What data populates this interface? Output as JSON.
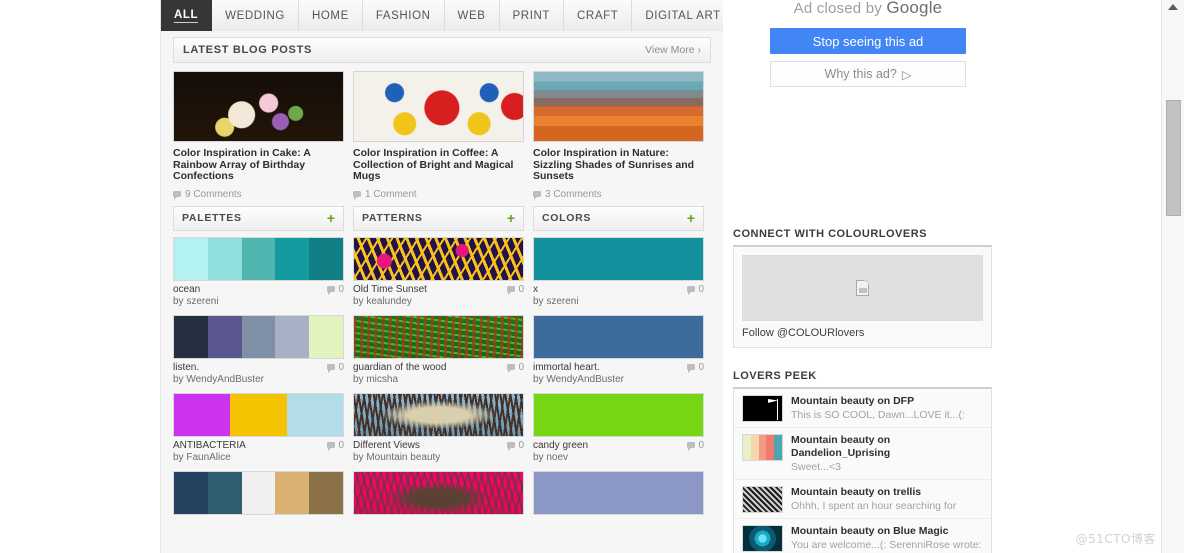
{
  "nav": {
    "tabs": [
      {
        "label": "ALL",
        "active": true
      },
      {
        "label": "WEDDING",
        "active": false
      },
      {
        "label": "HOME",
        "active": false
      },
      {
        "label": "FASHION",
        "active": false
      },
      {
        "label": "WEB",
        "active": false
      },
      {
        "label": "PRINT",
        "active": false
      },
      {
        "label": "CRAFT",
        "active": false
      },
      {
        "label": "DIGITAL ART",
        "active": false
      }
    ]
  },
  "blog_section": {
    "title": "LATEST BLOG POSTS",
    "more_label": "View More ›",
    "posts": [
      {
        "title": "Color Inspiration in Cake: A Rainbow Array of Birthday Confections",
        "comments": "9 Comments",
        "thumb": "img-cake"
      },
      {
        "title": "Color Inspiration in Coffee: A Collection of Bright and Magical Mugs",
        "comments": "1 Comment",
        "thumb": "img-mug"
      },
      {
        "title": "Color Inspiration in Nature: Sizzling Shades of Sunrises and Sunsets",
        "comments": "3 Comments",
        "thumb": "img-sunset"
      }
    ]
  },
  "columns": [
    {
      "title": "PALETTES",
      "add_icon": "plus-icon",
      "add_label": "+",
      "items": [
        {
          "name": "ocean",
          "by": "by szereni",
          "count": "0",
          "swatches": [
            "#b4f2f2",
            "#8fe0dd",
            "#4fb5ae",
            "#139ba0",
            "#0f7e85"
          ]
        },
        {
          "name": "listen.",
          "by": "by WendyAndBuster",
          "count": "0",
          "swatches": [
            "#24303f",
            "#5a5790",
            "#7f8fa6",
            "#a7b0c4",
            "#e2f3bd"
          ]
        },
        {
          "name": "ANTIBACTERIA",
          "by": "by FaunAlice",
          "count": "0",
          "swatches": [
            "#cc33ee",
            "#f5c400",
            "#b2dde8"
          ]
        },
        {
          "name": "",
          "by": "",
          "count": "",
          "swatches": [
            "#234260",
            "#2f5d72",
            "#f1eff0",
            "#d9b173",
            "#8a7148"
          ]
        }
      ]
    },
    {
      "title": "PATTERNS",
      "add_icon": "plus-icon",
      "add_label": "+",
      "items": [
        {
          "name": "Old Time Sunset",
          "by": "by kealundey",
          "count": "0",
          "pattern": "pat1"
        },
        {
          "name": "guardian of the wood",
          "by": "by micsha",
          "count": "0",
          "pattern": "pat2"
        },
        {
          "name": "Different Views",
          "by": "by Mountain beauty",
          "count": "0",
          "pattern": "pat3"
        },
        {
          "name": "",
          "by": "",
          "count": "",
          "pattern": "pat4"
        }
      ]
    },
    {
      "title": "COLORS",
      "add_icon": "plus-icon",
      "add_label": "+",
      "items": [
        {
          "name": "x",
          "by": "by szereni",
          "count": "0",
          "swatches": [
            "#13909c"
          ]
        },
        {
          "name": "immortal heart.",
          "by": "by WendyAndBuster",
          "count": "0",
          "swatches": [
            "#3d6b9c"
          ]
        },
        {
          "name": "candy green",
          "by": "by noev",
          "count": "0",
          "swatches": [
            "#76d614"
          ]
        },
        {
          "name": "",
          "by": "",
          "count": "",
          "swatches": [
            "#8b97c4"
          ]
        }
      ]
    }
  ],
  "ad": {
    "closed_text": "Ad closed by ",
    "closed_brand": "Google",
    "stop_label": "Stop seeing this ad",
    "why_label": "Why this ad?",
    "why_icon": "play-triangle-icon"
  },
  "connect": {
    "title": "CONNECT WITH COLOURLOVERS",
    "image_icon": "broken-image-icon",
    "follow_label": "Follow @COLOURlovers"
  },
  "lovers_peek": {
    "title": "LOVERS PEEK",
    "items": [
      {
        "title": "Mountain beauty on DFP",
        "text": "This is SO COOL, Dawn...LOVE it...(:",
        "thumb": "th-dfp"
      },
      {
        "title": "Mountain beauty on Dandelion_Uprising",
        "text": "Sweet...<3",
        "thumb": "th-dand"
      },
      {
        "title": "Mountain beauty on trellis",
        "text": "Ohhh, I spent an hour searching for",
        "thumb": "th-trellis"
      },
      {
        "title": "Mountain beauty on Blue Magic",
        "text": "You are welcome...(: SerenniRose wrote:",
        "thumb": "th-blue"
      }
    ]
  },
  "scrollbar": {
    "up_icon": "scroll-up-arrow-icon"
  },
  "watermark": "@51CTO博客",
  "colors": {
    "accent_green": "#6aa31f",
    "ad_blue": "#4285f4",
    "active_tab_bg": "#363636"
  }
}
